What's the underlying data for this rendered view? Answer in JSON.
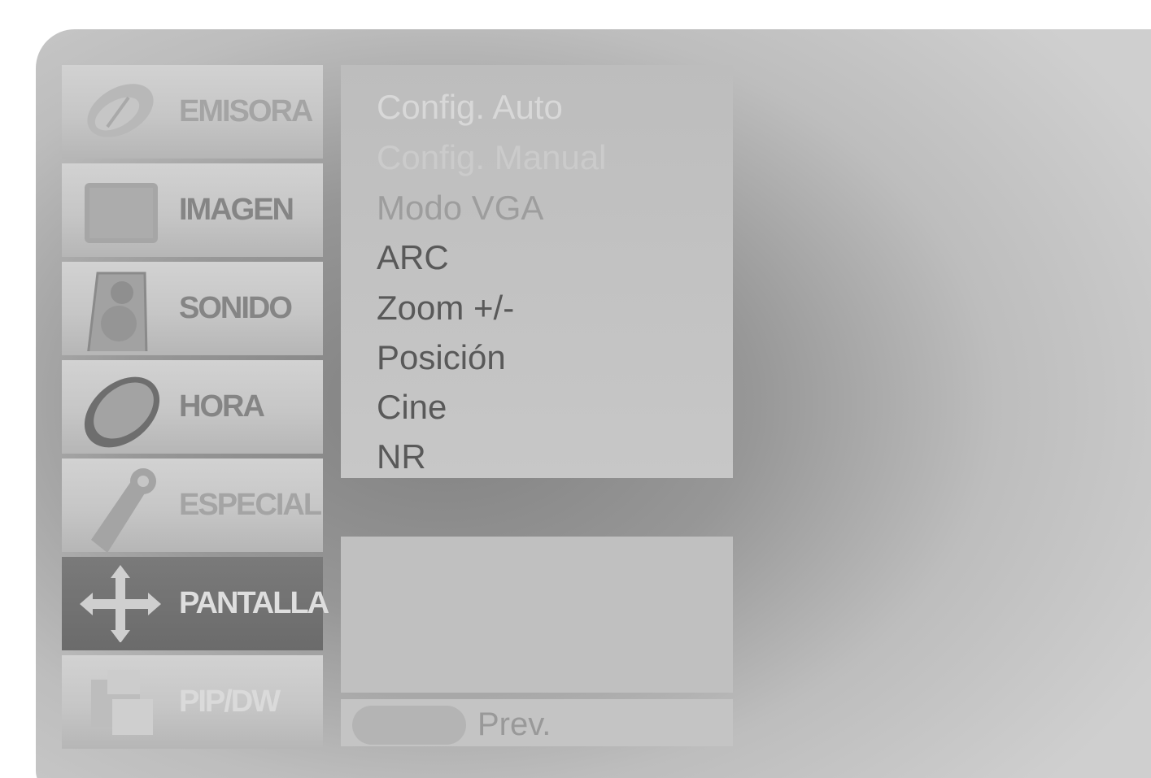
{
  "menu": {
    "items": [
      {
        "label": "EMISORA",
        "icon": "satellite-dish-icon"
      },
      {
        "label": "IMAGEN",
        "icon": "picture-icon"
      },
      {
        "label": "SONIDO",
        "icon": "speaker-icon"
      },
      {
        "label": "HORA",
        "icon": "clock-icon"
      },
      {
        "label": "ESPECIAL",
        "icon": "key-tag-icon"
      },
      {
        "label": "PANTALLA",
        "icon": "move-arrows-icon"
      },
      {
        "label": "PIP/DW",
        "icon": "pip-windows-icon"
      }
    ],
    "selected": "PANTALLA"
  },
  "submenu": {
    "items": [
      "Config. Auto",
      "Config. Manual",
      "Modo VGA",
      "ARC",
      "Zoom +/-",
      "Posición",
      "Cine",
      "NR"
    ]
  },
  "footer": {
    "prev_label": "Prev."
  }
}
